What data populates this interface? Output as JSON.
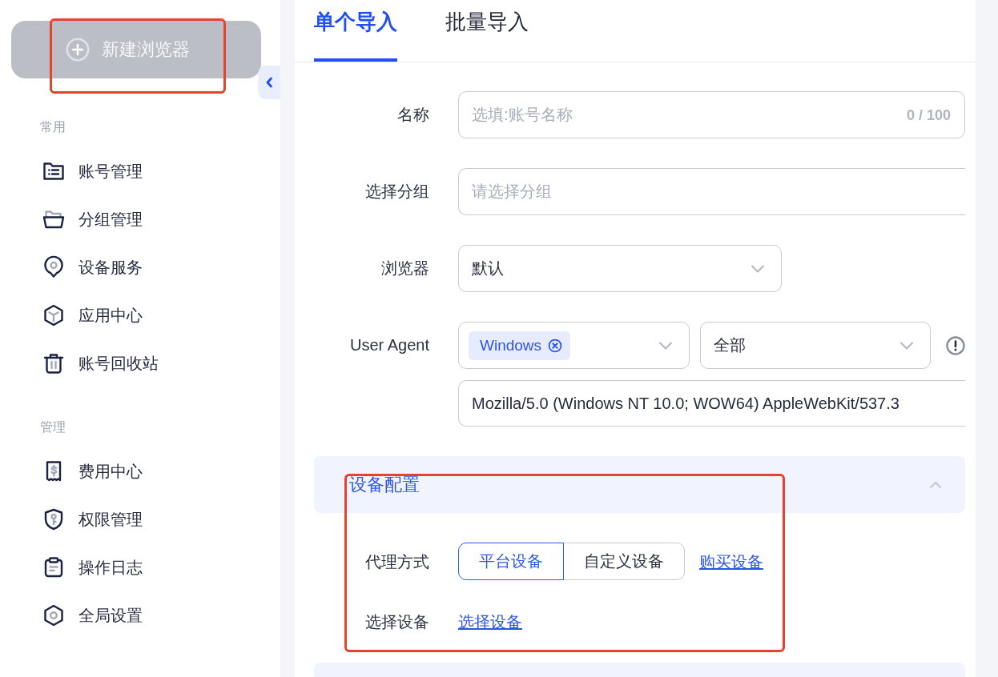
{
  "sidebar": {
    "new_button": {
      "label": "新建浏览器",
      "highlighted": true
    },
    "groups": [
      {
        "title": "常用",
        "items": [
          {
            "label": "账号管理",
            "selected": false
          },
          {
            "label": "分组管理",
            "selected": false
          },
          {
            "label": "设备服务",
            "selected": false
          },
          {
            "label": "应用中心",
            "selected": false
          },
          {
            "label": "账号回收站",
            "selected": false
          }
        ]
      },
      {
        "title": "管理",
        "items": [
          {
            "label": "费用中心",
            "selected": false
          },
          {
            "label": "权限管理",
            "selected": false
          },
          {
            "label": "操作日志",
            "selected": false
          },
          {
            "label": "全局设置",
            "selected": false
          }
        ]
      }
    ]
  },
  "tabs": [
    {
      "label": "单个导入",
      "selected": true
    },
    {
      "label": "批量导入",
      "selected": false
    }
  ],
  "form": {
    "fields": [
      {
        "kind": "text",
        "label": "名称",
        "placeholder": "选填:账号名称",
        "counter": "0 / 100"
      },
      {
        "kind": "picker",
        "label": "选择分组",
        "placeholder": "请选择分组"
      },
      {
        "kind": "select",
        "label": "浏览器",
        "value": "默认"
      },
      {
        "kind": "user_agent",
        "label": "User Agent",
        "tags": [
          "Windows"
        ],
        "version": "全部",
        "value": "Mozilla/5.0 (Windows NT 10.0; WOW64) AppleWebKit/537.3"
      }
    ]
  },
  "sections": [
    {
      "title": "设备配置",
      "expanded": true,
      "highlighted": true,
      "rows": [
        {
          "kind": "segmented",
          "label": "代理方式",
          "options": [
            {
              "label": "平台设备",
              "selected": true
            },
            {
              "label": "自定义设备",
              "selected": false
            }
          ],
          "link": "购买设备"
        },
        {
          "kind": "link",
          "label": "选择设备",
          "link": "选择设备"
        }
      ]
    }
  ]
}
